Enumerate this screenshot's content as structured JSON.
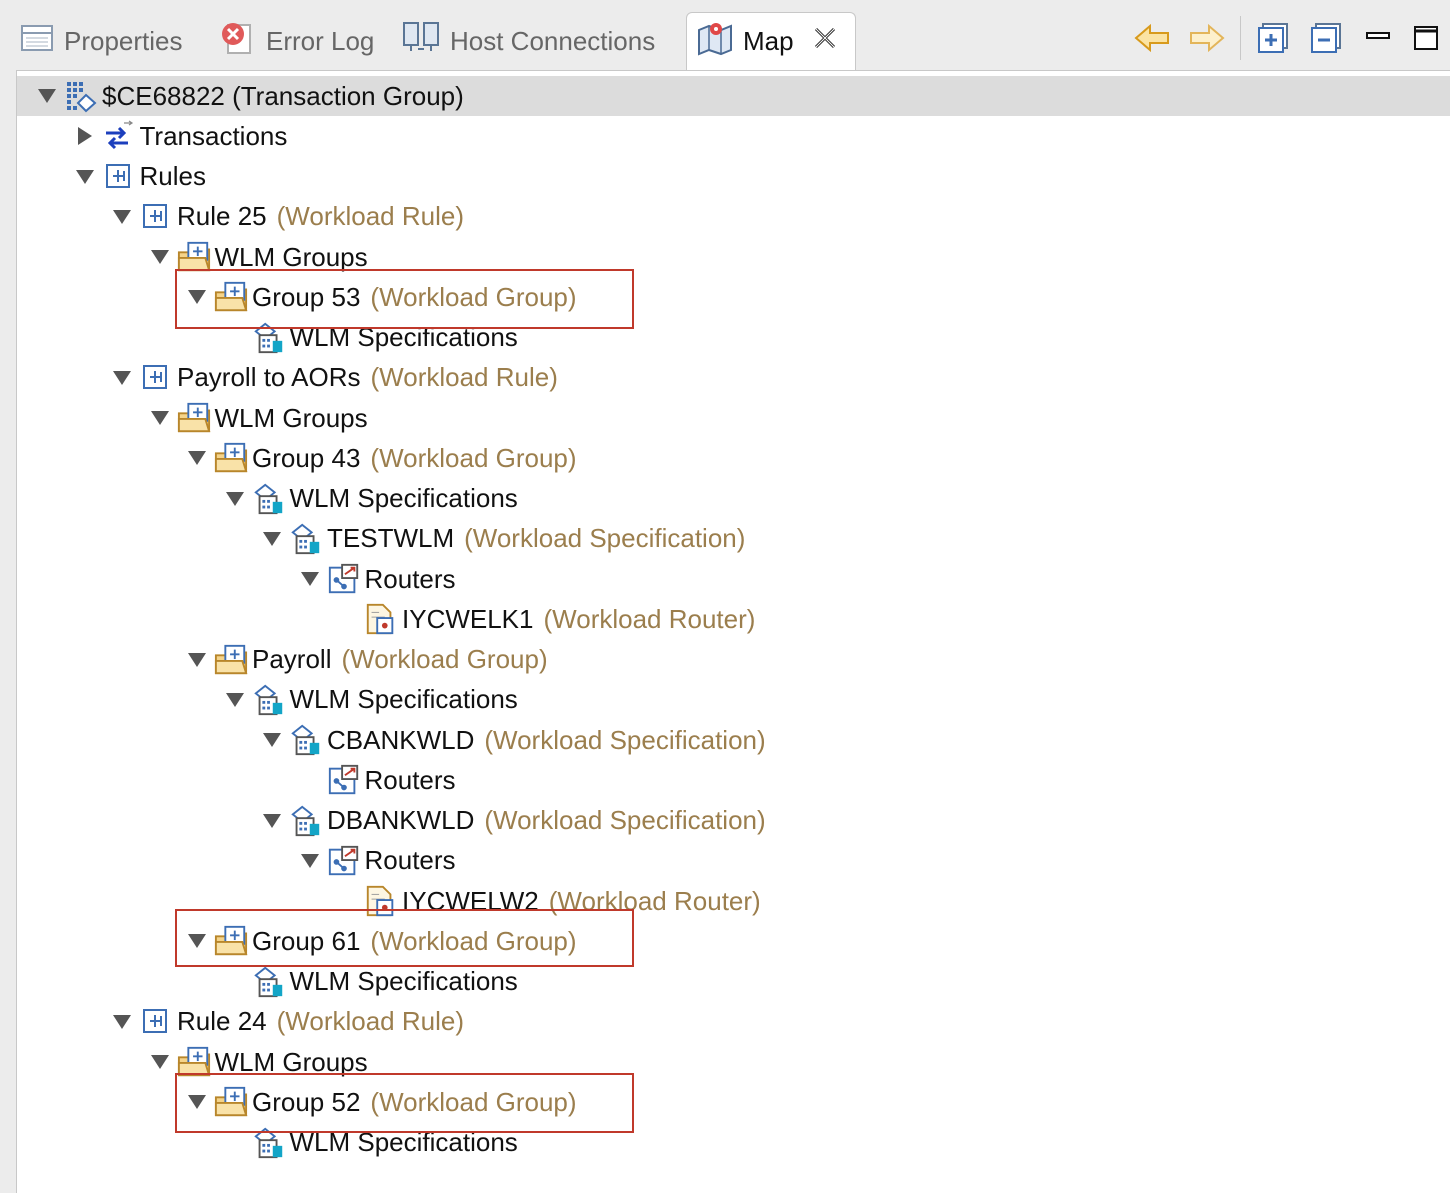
{
  "tabs": [
    {
      "label": "Properties",
      "icon": "properties-icon",
      "active": false
    },
    {
      "label": "Error Log",
      "icon": "error-log-icon",
      "active": false
    },
    {
      "label": "Host Connections",
      "icon": "host-connections-icon",
      "active": false
    },
    {
      "label": "Map",
      "icon": "map-icon",
      "active": true
    }
  ],
  "toolbar": {
    "back_icon": "back-arrow-icon",
    "forward_icon": "forward-arrow-icon",
    "expand_all_icon": "expand-all-icon",
    "collapse_all_icon": "collapse-all-icon",
    "minimize_icon": "minimize-icon",
    "maximize_icon": "maximize-icon"
  },
  "colors": {
    "type_label": "#9b7e4d",
    "highlight": "#c0392b"
  },
  "tree": [
    {
      "label": "$CE68822 (Transaction Group)",
      "type": "",
      "state": "expanded",
      "icon": "transaction-group-icon"
    },
    {
      "label": "Transactions",
      "type": "",
      "state": "collapsed",
      "icon": "transactions-icon"
    },
    {
      "label": "Rules",
      "type": "",
      "state": "expanded",
      "icon": "rule-icon"
    },
    {
      "label": "Rule 25",
      "type": "(Workload Rule)",
      "state": "expanded",
      "icon": "rule-icon"
    },
    {
      "label": "WLM Groups",
      "type": "",
      "state": "expanded",
      "icon": "wlm-groups-icon"
    },
    {
      "label": "Group 53",
      "type": "(Workload Group)",
      "state": "expanded",
      "icon": "workload-group-icon"
    },
    {
      "label": "WLM Specifications",
      "type": "",
      "state": "leaf",
      "icon": "wlm-specifications-icon"
    },
    {
      "label": "Payroll to AORs",
      "type": "(Workload Rule)",
      "state": "expanded",
      "icon": "rule-icon"
    },
    {
      "label": "WLM Groups",
      "type": "",
      "state": "expanded",
      "icon": "wlm-groups-icon"
    },
    {
      "label": "Group 43",
      "type": "(Workload Group)",
      "state": "expanded",
      "icon": "workload-group-icon"
    },
    {
      "label": "WLM Specifications",
      "type": "",
      "state": "expanded",
      "icon": "wlm-specifications-icon"
    },
    {
      "label": "TESTWLM",
      "type": "(Workload Specification)",
      "state": "expanded",
      "icon": "workload-specification-icon"
    },
    {
      "label": "Routers",
      "type": "",
      "state": "expanded",
      "icon": "routers-icon"
    },
    {
      "label": "IYCWELK1",
      "type": "(Workload Router)",
      "state": "leaf",
      "icon": "workload-router-icon"
    },
    {
      "label": "Payroll",
      "type": "(Workload Group)",
      "state": "expanded",
      "icon": "workload-group-icon"
    },
    {
      "label": "WLM Specifications",
      "type": "",
      "state": "expanded",
      "icon": "wlm-specifications-icon"
    },
    {
      "label": "CBANKWLD",
      "type": "(Workload Specification)",
      "state": "expanded",
      "icon": "workload-specification-icon"
    },
    {
      "label": "Routers",
      "type": "",
      "state": "leaf",
      "icon": "routers-icon"
    },
    {
      "label": "DBANKWLD",
      "type": "(Workload Specification)",
      "state": "expanded",
      "icon": "workload-specification-icon"
    },
    {
      "label": "Routers",
      "type": "",
      "state": "expanded",
      "icon": "routers-icon"
    },
    {
      "label": "IYCWELW2",
      "type": "(Workload Router)",
      "state": "leaf",
      "icon": "workload-router-icon"
    },
    {
      "label": "Group 61",
      "type": "(Workload Group)",
      "state": "expanded",
      "icon": "workload-group-icon"
    },
    {
      "label": "WLM Specifications",
      "type": "",
      "state": "leaf",
      "icon": "wlm-specifications-icon"
    },
    {
      "label": "Rule 24",
      "type": "(Workload Rule)",
      "state": "expanded",
      "icon": "rule-icon"
    },
    {
      "label": "WLM Groups",
      "type": "",
      "state": "expanded",
      "icon": "wlm-groups-icon"
    },
    {
      "label": "Group 52",
      "type": "(Workload Group)",
      "state": "expanded",
      "icon": "workload-group-icon"
    },
    {
      "label": "WLM Specifications",
      "type": "",
      "state": "leaf",
      "icon": "wlm-specifications-icon"
    }
  ],
  "highlighted_items": [
    "Group 53",
    "Group 61",
    "Group 52"
  ]
}
